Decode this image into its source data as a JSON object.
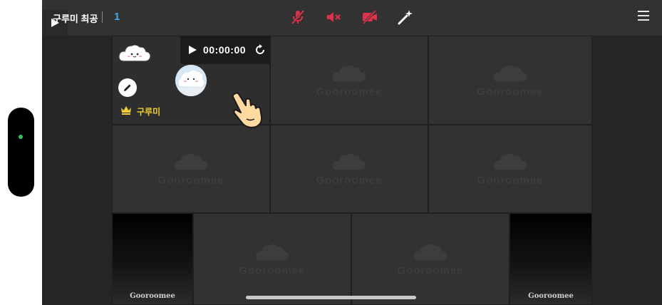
{
  "topbar": {
    "room_name": "구루미 최공",
    "participant_count": "1"
  },
  "controls": {
    "mic": {
      "icon": "mic-off-icon",
      "color": "#e0314b"
    },
    "speaker": {
      "icon": "speaker-muted-icon",
      "color": "#e0314b"
    },
    "camera": {
      "icon": "camera-off-icon",
      "color": "#e0314b"
    },
    "effects": {
      "icon": "magic-wand-icon",
      "color": "#ffffff"
    },
    "menu": {
      "icon": "menu-icon"
    }
  },
  "host_tile": {
    "host_name": "구루미",
    "badge_icon": "crown-icon",
    "badge_color": "#f2d12e"
  },
  "timer": {
    "time": "00:00:00"
  },
  "tiles": {
    "watermark": "Gooroomee",
    "dark_watermark": "Gooroomee"
  },
  "side_indicator": {
    "status_color": "#33c25a"
  }
}
